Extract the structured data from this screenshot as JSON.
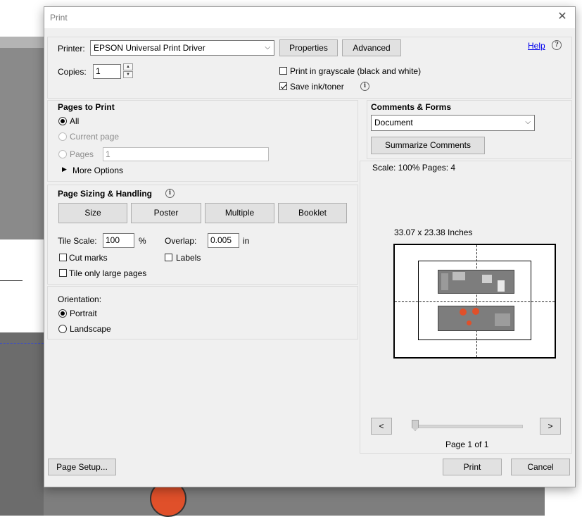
{
  "dialog": {
    "title": "Print"
  },
  "printer": {
    "label": "Printer:",
    "selected": "EPSON Universal Print Driver",
    "properties_label": "Properties",
    "advanced_label": "Advanced",
    "help_label": "Help",
    "copies_label": "Copies:",
    "copies_value": "1",
    "grayscale_label": "Print in grayscale (black and white)",
    "grayscale_checked": false,
    "save_ink_label": "Save ink/toner",
    "save_ink_checked": true
  },
  "pages_to_print": {
    "heading": "Pages to Print",
    "all_label": "All",
    "current_page_label": "Current page",
    "pages_label": "Pages",
    "pages_value": "1",
    "more_options_label": "More Options",
    "selected": "All"
  },
  "page_sizing": {
    "heading": "Page Sizing & Handling",
    "tabs": [
      {
        "label": "Size"
      },
      {
        "label": "Poster"
      },
      {
        "label": "Multiple"
      },
      {
        "label": "Booklet"
      }
    ],
    "tile_scale_label": "Tile Scale:",
    "tile_scale_value": "100",
    "tile_scale_unit": "%",
    "overlap_label": "Overlap:",
    "overlap_value": "0.005",
    "overlap_unit": "in",
    "cut_marks_label": "Cut marks",
    "cut_marks_checked": false,
    "labels_label": "Labels",
    "labels_checked": false,
    "tile_large_label": "Tile only large pages",
    "tile_large_checked": false
  },
  "orientation": {
    "heading": "Orientation:",
    "portrait_label": "Portrait",
    "landscape_label": "Landscape",
    "selected": "Portrait"
  },
  "comments_forms": {
    "heading": "Comments & Forms",
    "selected": "Document",
    "summarize_label": "Summarize Comments"
  },
  "preview": {
    "scale_text": "Scale: 100% Pages: 4",
    "size_text": "33.07 x 23.38 Inches",
    "prev_label": "<",
    "next_label": ">",
    "page_indicator": "Page 1 of 1",
    "slider_position": 0
  },
  "footer": {
    "page_setup_label": "Page Setup...",
    "print_label": "Print",
    "cancel_label": "Cancel"
  },
  "colors": {
    "dialog_bg": "#f0f0f0",
    "button_bg": "#e1e1e1",
    "link": "#0000ee",
    "drawing_accent": "#e0502a"
  }
}
